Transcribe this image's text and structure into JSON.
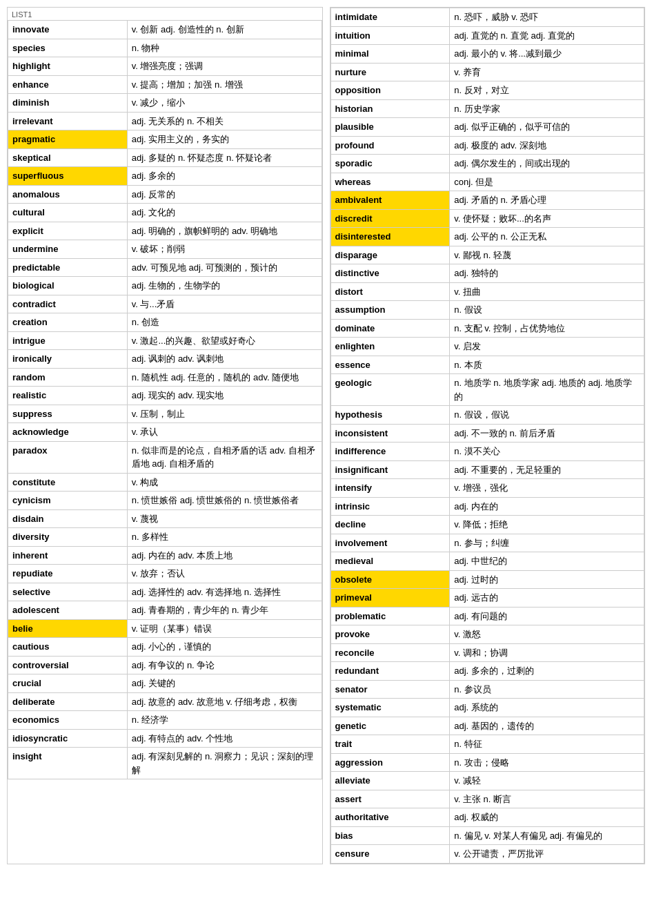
{
  "left_column": {
    "title": "LIST1",
    "rows": [
      {
        "word": "innovate",
        "def": "v. 创新 adj. 创造性的 n. 创新",
        "highlight": ""
      },
      {
        "word": "species",
        "def": "n. 物种",
        "highlight": ""
      },
      {
        "word": "highlight",
        "def": "v. 增强亮度；强调",
        "highlight": ""
      },
      {
        "word": "enhance",
        "def": "v. 提高；增加；加强 n. 增强",
        "highlight": ""
      },
      {
        "word": "diminish",
        "def": "v. 减少，缩小",
        "highlight": ""
      },
      {
        "word": "irrelevant",
        "def": "adj. 无关系的 n. 不相关",
        "highlight": ""
      },
      {
        "word": "pragmatic",
        "def": "adj. 实用主义的，务实的",
        "highlight": "yellow"
      },
      {
        "word": "skeptical",
        "def": "adj. 多疑的 n. 怀疑态度 n. 怀疑论者",
        "highlight": ""
      },
      {
        "word": "superfluous",
        "def": "adj. 多余的",
        "highlight": "yellow"
      },
      {
        "word": "anomalous",
        "def": "adj. 反常的",
        "highlight": ""
      },
      {
        "word": "cultural",
        "def": "adj. 文化的",
        "highlight": ""
      },
      {
        "word": "explicit",
        "def": "adj. 明确的，旗帜鲜明的 adv. 明确地",
        "highlight": "",
        "multiline": true
      },
      {
        "word": "undermine",
        "def": "v. 破坏；削弱",
        "highlight": ""
      },
      {
        "word": "predictable",
        "def": "adv. 可预见地 adj. 可预测的，预计的",
        "highlight": "",
        "multiline": true
      },
      {
        "word": "biological",
        "def": "adj. 生物的，生物学的",
        "highlight": ""
      },
      {
        "word": "contradict",
        "def": "v. 与...矛盾",
        "highlight": ""
      },
      {
        "word": "creation",
        "def": "n. 创造",
        "highlight": ""
      },
      {
        "word": "intrigue",
        "def": "v. 激起...的兴趣、欲望或好奇心",
        "highlight": ""
      },
      {
        "word": "ironically",
        "def": "adj. 讽刺的 adv. 讽刺地",
        "highlight": ""
      },
      {
        "word": "random",
        "def": "n. 随机性 adj. 任意的，随机的 adv. 随便地",
        "highlight": "",
        "multiline": true
      },
      {
        "word": "realistic",
        "def": "adj. 现实的 adv. 现实地",
        "highlight": ""
      },
      {
        "word": "suppress",
        "def": "v. 压制，制止",
        "highlight": ""
      },
      {
        "word": "acknowledge",
        "def": "v. 承认",
        "highlight": ""
      },
      {
        "word": "paradox",
        "def": "n. 似非而是的论点，自相矛盾的话 adv. 自相矛盾地 adj. 自相矛盾的",
        "highlight": "",
        "multiline": true
      },
      {
        "word": "constitute",
        "def": "v. 构成",
        "highlight": ""
      },
      {
        "word": "cynicism",
        "def": "n. 愤世嫉俗 adj. 愤世嫉俗的 n. 愤世嫉俗者",
        "highlight": "",
        "multiline": true
      },
      {
        "word": "disdain",
        "def": "v. 蔑视",
        "highlight": ""
      },
      {
        "word": "diversity",
        "def": "n. 多样性",
        "highlight": ""
      },
      {
        "word": "inherent",
        "def": "adj. 内在的 adv. 本质上地",
        "highlight": ""
      },
      {
        "word": "repudiate",
        "def": "v. 放弃；否认",
        "highlight": ""
      },
      {
        "word": "selective",
        "def": "adj. 选择性的 adv. 有选择地 n. 选择性",
        "highlight": "",
        "multiline": true
      },
      {
        "word": "adolescent",
        "def": "adj. 青春期的，青少年的 n. 青少年",
        "highlight": "",
        "multiline": true
      },
      {
        "word": "belie",
        "def": "v. 证明（某事）错误",
        "highlight": "yellow"
      },
      {
        "word": "cautious",
        "def": "adj. 小心的，谨慎的",
        "highlight": ""
      },
      {
        "word": "controversial",
        "def": "adj. 有争议的 n. 争论",
        "highlight": ""
      },
      {
        "word": "crucial",
        "def": "adj. 关键的",
        "highlight": ""
      },
      {
        "word": "deliberate",
        "def": "adj. 故意的 adv. 故意地 v. 仔细考虑，权衡",
        "highlight": "",
        "multiline": true
      },
      {
        "word": "economics",
        "def": "n. 经济学",
        "highlight": ""
      },
      {
        "word": "idiosyncratic",
        "def": "adj. 有特点的 adv. 个性地",
        "highlight": ""
      },
      {
        "word": "insight",
        "def": "adj. 有深刻见解的 n. 洞察力；见识；深刻的理解",
        "highlight": "",
        "multiline": true
      }
    ]
  },
  "right_column": {
    "rows": [
      {
        "word": "intimidate",
        "def": "n. 恐吓，威胁 v. 恐吓",
        "highlight": ""
      },
      {
        "word": "intuition",
        "def": "adj. 直觉的 n. 直觉 adj. 直觉的",
        "highlight": ""
      },
      {
        "word": "minimal",
        "def": "adj. 最小的 v. 将...减到最少",
        "highlight": ""
      },
      {
        "word": "nurture",
        "def": "v. 养育",
        "highlight": ""
      },
      {
        "word": "opposition",
        "def": "n. 反对，对立",
        "highlight": ""
      },
      {
        "word": "historian",
        "def": "n. 历史学家",
        "highlight": ""
      },
      {
        "word": "plausible",
        "def": "adj. 似乎正确的，似乎可信的",
        "highlight": ""
      },
      {
        "word": "profound",
        "def": "adj. 极度的 adv. 深刻地",
        "highlight": ""
      },
      {
        "word": "sporadic",
        "def": "adj. 偶尔发生的，间或出现的",
        "highlight": ""
      },
      {
        "word": "whereas",
        "def": "conj. 但是",
        "highlight": ""
      },
      {
        "word": "ambivalent",
        "def": "adj. 矛盾的 n. 矛盾心理",
        "highlight": "yellow"
      },
      {
        "word": "discredit",
        "def": "v. 使怀疑；败坏...的名声",
        "highlight": "yellow"
      },
      {
        "word": "disinterested",
        "def": "adj. 公平的 n. 公正无私",
        "highlight": "yellow"
      },
      {
        "word": "disparage",
        "def": "v. 鄙视 n. 轻蔑",
        "highlight": ""
      },
      {
        "word": "distinctive",
        "def": "adj. 独特的",
        "highlight": ""
      },
      {
        "word": "distort",
        "def": "v. 扭曲",
        "highlight": ""
      },
      {
        "word": "assumption",
        "def": "n. 假设",
        "highlight": ""
      },
      {
        "word": "dominate",
        "def": "n. 支配 v. 控制，占优势地位",
        "highlight": ""
      },
      {
        "word": "enlighten",
        "def": "v. 启发",
        "highlight": ""
      },
      {
        "word": "essence",
        "def": "n. 本质",
        "highlight": ""
      },
      {
        "word": "geologic",
        "def": "n. 地质学 n. 地质学家 adj. 地质的 adj. 地质学的",
        "highlight": "",
        "multiline": true
      },
      {
        "word": "hypothesis",
        "def": "n. 假设，假说",
        "highlight": ""
      },
      {
        "word": "inconsistent",
        "def": "adj. 不一致的 n. 前后矛盾",
        "highlight": ""
      },
      {
        "word": "indifference",
        "def": "n. 漠不关心",
        "highlight": ""
      },
      {
        "word": "insignificant",
        "def": "adj. 不重要的，无足轻重的",
        "highlight": ""
      },
      {
        "word": "intensify",
        "def": "v. 增强，强化",
        "highlight": ""
      },
      {
        "word": "intrinsic",
        "def": "adj. 内在的",
        "highlight": ""
      },
      {
        "word": "decline",
        "def": "v. 降低；拒绝",
        "highlight": ""
      },
      {
        "word": "involvement",
        "def": "n. 参与；纠缠",
        "highlight": ""
      },
      {
        "word": "medieval",
        "def": "adj. 中世纪的",
        "highlight": ""
      },
      {
        "word": "obsolete",
        "def": "adj. 过时的",
        "highlight": "yellow"
      },
      {
        "word": "primeval",
        "def": "adj. 远古的",
        "highlight": "yellow"
      },
      {
        "word": "problematic",
        "def": "adj. 有问题的",
        "highlight": ""
      },
      {
        "word": "provoke",
        "def": "v. 激怒",
        "highlight": ""
      },
      {
        "word": "reconcile",
        "def": "v. 调和；协调",
        "highlight": ""
      },
      {
        "word": "redundant",
        "def": "adj. 多余的，过剩的",
        "highlight": ""
      },
      {
        "word": "senator",
        "def": "n. 参议员",
        "highlight": ""
      },
      {
        "word": "systematic",
        "def": "adj. 系统的",
        "highlight": ""
      },
      {
        "word": "genetic",
        "def": "adj. 基因的，遗传的",
        "highlight": ""
      },
      {
        "word": "trait",
        "def": "n. 特征",
        "highlight": ""
      },
      {
        "word": "aggression",
        "def": "n. 攻击；侵略",
        "highlight": ""
      },
      {
        "word": "alleviate",
        "def": "v. 减轻",
        "highlight": ""
      },
      {
        "word": "assert",
        "def": "v. 主张 n. 断言",
        "highlight": ""
      },
      {
        "word": "authoritative",
        "def": "adj. 权威的",
        "highlight": ""
      },
      {
        "word": "bias",
        "def": "n. 偏见 v. 对某人有偏见 adj. 有偏见的",
        "highlight": "",
        "multiline": true
      },
      {
        "word": "censure",
        "def": "v. 公开谴责，严厉批评",
        "highlight": ""
      }
    ]
  }
}
